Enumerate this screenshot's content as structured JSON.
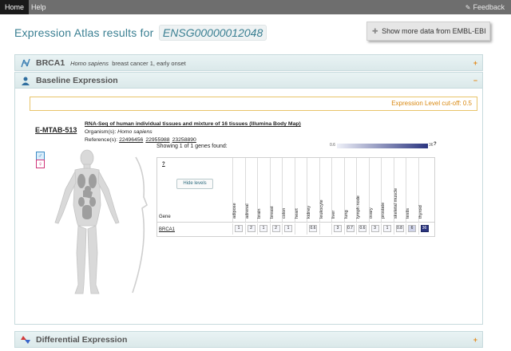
{
  "nav": {
    "home": "Home",
    "help": "Help",
    "feedback": "Feedback"
  },
  "title": {
    "prefix": "Expression Atlas results for",
    "gene_id": "ENSG00000012048"
  },
  "show_more": "Show more data from EMBL-EBI",
  "panels": {
    "brca1": {
      "title": "BRCA1",
      "species": "Homo sapiens",
      "desc": "breast cancer 1, early onset",
      "toggle": "+"
    },
    "baseline": {
      "title": "Baseline Expression",
      "toggle": "−"
    },
    "differential": {
      "title": "Differential Expression",
      "toggle": "+"
    }
  },
  "cutoff": "Expression Level cut-off: 0.5",
  "experiment": {
    "accession": "E-MTAB-513",
    "title": "RNA-Seq of human individual tissues and mixture of 16 tissues (Illumina Body Map)",
    "organism_label": "Organism(s):",
    "organism": "Homo sapiens",
    "refs_label": "Reference(s):",
    "refs": [
      "22496456",
      "22955988",
      "23258890"
    ]
  },
  "showing": "Showing 1 of 1 genes found:",
  "scale": {
    "min": "0.6",
    "max": "36",
    "help": "?"
  },
  "sex_icons": {
    "male": "♂",
    "female": "♀"
  },
  "table": {
    "help": "?",
    "hide_levels": "Hide levels",
    "gene_header": "Gene",
    "gene": "BRCA1",
    "tissues": [
      "adipose",
      "adrenal",
      "brain",
      "breast",
      "colon",
      "heart",
      "kidney",
      "leukocyte",
      "liver",
      "lung",
      "lymph node",
      "ovary",
      "prostate",
      "skeletal muscle",
      "testis",
      "thyroid"
    ],
    "values": [
      "1",
      "2",
      "1",
      "2",
      "1",
      "",
      "0.6",
      "",
      "3",
      "0.7",
      "0.6",
      "3",
      "1",
      "0.8",
      "6",
      "36"
    ]
  }
}
